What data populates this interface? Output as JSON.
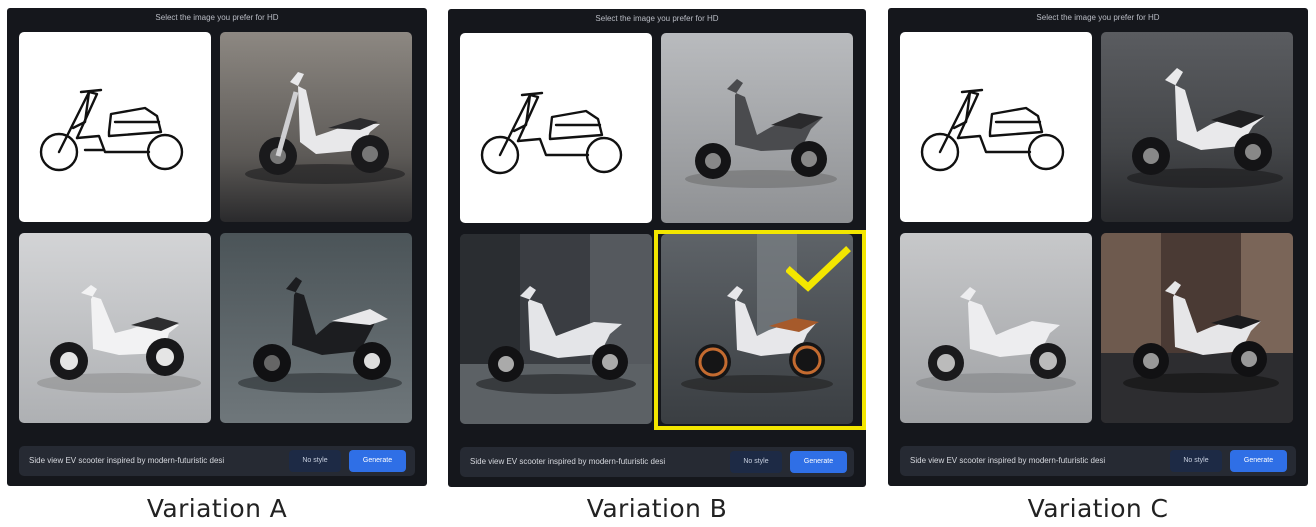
{
  "panels": [
    {
      "id": "a",
      "instruction": "Select the image you prefer for HD",
      "prompt_text": "Side view EV scooter inspired by modern-futuristic desi",
      "style_button_label": "No style",
      "generate_button_label": "Generate",
      "caption": "Variation A"
    },
    {
      "id": "b",
      "instruction": "Select the image you prefer for HD",
      "prompt_text": "Side view EV scooter inspired by modern-futuristic desi",
      "style_button_label": "No style",
      "generate_button_label": "Generate",
      "caption": "Variation B",
      "selected_tile": 4
    },
    {
      "id": "c",
      "instruction": "Select the image you prefer for HD",
      "prompt_text": "Side view EV scooter inspired by modern-futuristic desi",
      "style_button_label": "No style",
      "generate_button_label": "Generate",
      "caption": "Variation C"
    }
  ],
  "icons": {
    "selection_mark": "checkmark-icon"
  },
  "colors": {
    "panel_background": "#15171c",
    "selection_highlight": "#f3e600",
    "generate_button": "#2f6fe6",
    "style_button": "#1d2a45"
  }
}
